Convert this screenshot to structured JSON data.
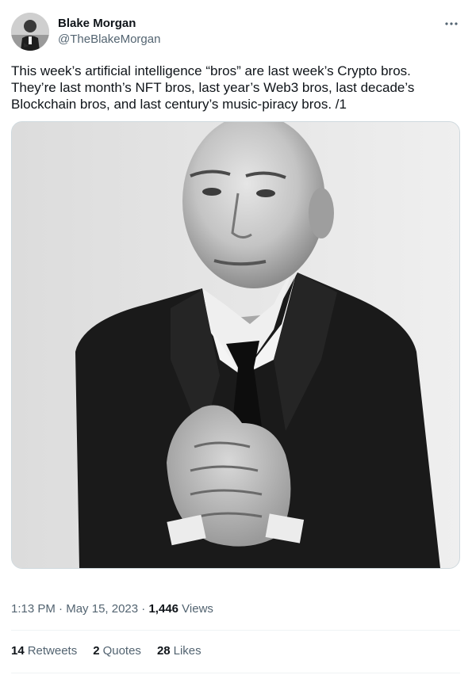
{
  "author": {
    "name": "Blake Morgan",
    "handle": "@TheBlakeMorgan"
  },
  "more_icon": "more-horizontal-icon",
  "tweet": {
    "text": "This week’s artificial intelligence “bros” are last week’s Crypto bros.\nThey’re last month’s NFT bros, last year’s Web3 bros, last decade’s\nBlockchain bros, and last century’s music-piracy bros. /1"
  },
  "meta": {
    "time": "1:13 PM",
    "sep1": " · ",
    "date": "May 15, 2023",
    "sep2": " · ",
    "views_count": "1,446",
    "views_label": " Views"
  },
  "stats": {
    "retweets_count": "14",
    "retweets_label": "Retweets",
    "quotes_count": "2",
    "quotes_label": "Quotes",
    "likes_count": "28",
    "likes_label": "Likes"
  },
  "colors": {
    "text": "#0f1419",
    "secondary": "#536471",
    "divider": "#eff3f4"
  }
}
